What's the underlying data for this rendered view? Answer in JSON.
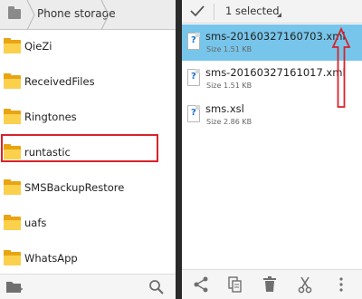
{
  "breadcrumb": {
    "current": "Phone storage"
  },
  "folders": [
    {
      "name": "QieZi"
    },
    {
      "name": "ReceivedFiles"
    },
    {
      "name": "Ringtones"
    },
    {
      "name": "runtastic"
    },
    {
      "name": "SMSBackupRestore"
    },
    {
      "name": "uafs"
    },
    {
      "name": "WhatsApp"
    }
  ],
  "selection": {
    "count_label": "1 selected"
  },
  "files": [
    {
      "name": "sms-20160327160703.xml",
      "size": "Size 1.51 KB",
      "selected": true
    },
    {
      "name": "sms-20160327161017.xml",
      "size": "Size 1.51 KB",
      "selected": false
    },
    {
      "name": "sms.xsl",
      "size": "Size 2.86 KB",
      "selected": false
    }
  ],
  "colors": {
    "selection_blue": "#77c5ea",
    "annotation_red": "#d9232a",
    "folder_yellow": "#fbd04d"
  },
  "icons": {
    "left_toolbar": [
      "new-folder-icon",
      "search-icon"
    ],
    "right_toolbar": [
      "share-icon",
      "copy-icon",
      "delete-icon",
      "cut-icon",
      "more-icon"
    ]
  }
}
